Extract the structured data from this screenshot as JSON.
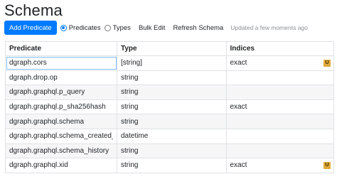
{
  "page": {
    "title": "Schema"
  },
  "toolbar": {
    "add_predicate": "Add Predicate",
    "radio_predicates": "Predicates",
    "radio_types": "Types",
    "bulk_edit": "Bulk Edit",
    "refresh_schema": "Refresh Schema",
    "status": "Updated a few moments ago",
    "selected_view": "Predicates"
  },
  "table": {
    "headers": {
      "predicate": "Predicate",
      "type": "Type",
      "indices": "Indices"
    },
    "rows": [
      {
        "predicate": "dgraph.cors",
        "type": "[string]",
        "indices": "exact",
        "badge": "U"
      },
      {
        "predicate": "dgraph.drop.op",
        "type": "string",
        "indices": "",
        "badge": ""
      },
      {
        "predicate": "dgraph.graphql.p_query",
        "type": "string",
        "indices": "",
        "badge": ""
      },
      {
        "predicate": "dgraph.graphql.p_sha256hash",
        "type": "string",
        "indices": "exact",
        "badge": ""
      },
      {
        "predicate": "dgraph.graphql.schema",
        "type": "string",
        "indices": "",
        "badge": ""
      },
      {
        "predicate": "dgraph.graphql.schema_created_a",
        "type": "datetime",
        "indices": "",
        "badge": ""
      },
      {
        "predicate": "dgraph.graphql.schema_history",
        "type": "string",
        "indices": "",
        "badge": ""
      },
      {
        "predicate": "dgraph.graphql.xid",
        "type": "string",
        "indices": "exact",
        "badge": "U"
      }
    ]
  },
  "colors": {
    "primary": "#007bff",
    "badge": "#e0a93a",
    "stripe": "#f6f6f6"
  }
}
